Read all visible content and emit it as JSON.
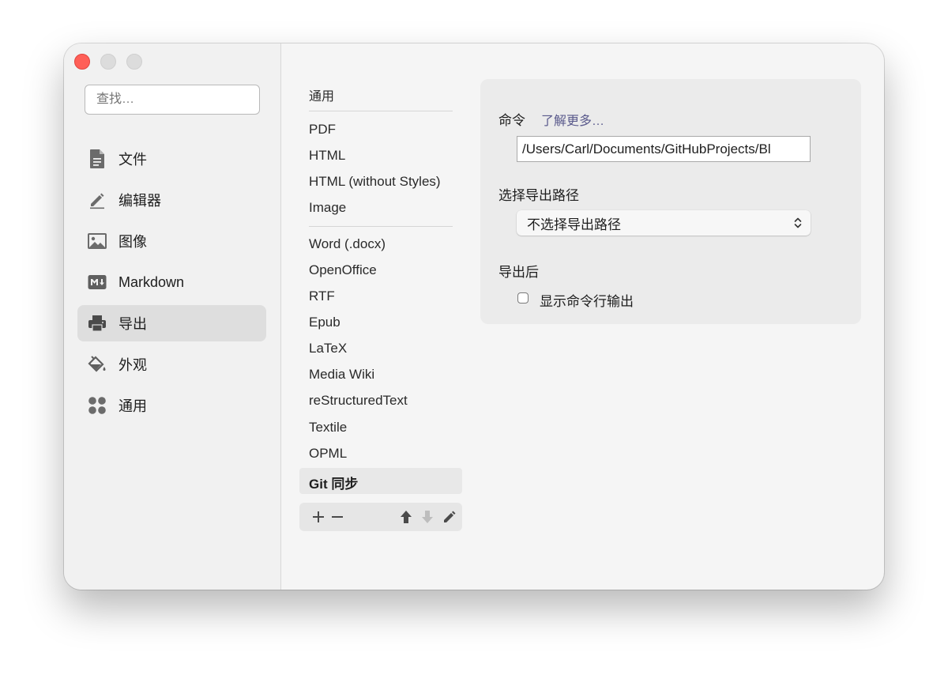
{
  "search": {
    "placeholder": "查找…"
  },
  "sidebar": {
    "items": [
      {
        "label": "文件",
        "icon": "document-icon"
      },
      {
        "label": "编辑器",
        "icon": "pencil-icon"
      },
      {
        "label": "图像",
        "icon": "image-icon"
      },
      {
        "label": "Markdown",
        "icon": "markdown-icon"
      },
      {
        "label": "导出",
        "icon": "printer-icon",
        "active": true
      },
      {
        "label": "外观",
        "icon": "paint-bucket-icon"
      },
      {
        "label": "通用",
        "icon": "grid-dots-icon"
      }
    ]
  },
  "formats": {
    "header": "通用",
    "group1": [
      "PDF",
      "HTML",
      "HTML (without Styles)",
      "Image"
    ],
    "group2": [
      "Word (.docx)",
      "OpenOffice",
      "RTF",
      "Epub",
      "LaTeX",
      "Media Wiki",
      "reStructuredText",
      "Textile",
      "OPML"
    ],
    "selected": "Git 同步"
  },
  "toolbar": {
    "add": "+",
    "remove": "−",
    "icons": [
      "arrow-up-icon",
      "arrow-down-icon",
      "pencil-icon"
    ]
  },
  "panel": {
    "command_label": "命令",
    "learn_more": "了解更多…",
    "command_value": "/Users/Carl/Documents/GitHubProjects/Bl",
    "path_label": "选择导出路径",
    "path_option": "不选择导出路径",
    "after_label": "导出后",
    "show_output_label": "显示命令行输出",
    "show_output_checked": false
  },
  "colors": {
    "close": "#ff5f57",
    "link": "#5a5a8c",
    "active_bg": "#dedede"
  }
}
